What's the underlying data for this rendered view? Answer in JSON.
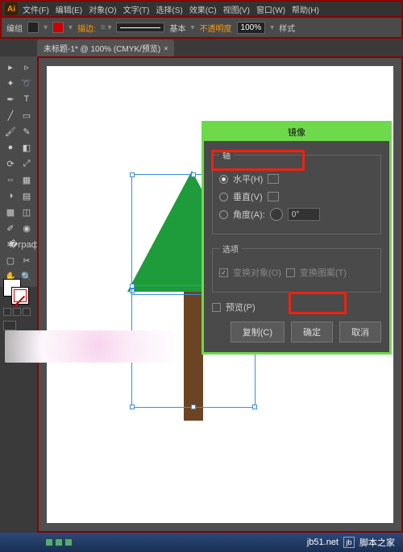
{
  "app": {
    "logo": "Ai"
  },
  "menu": {
    "file": "文件(F)",
    "edit": "编辑(E)",
    "object": "对象(O)",
    "type": "文字(T)",
    "select": "选择(S)",
    "effect": "效果(C)",
    "view": "视图(V)",
    "window": "窗口(W)",
    "help": "帮助(H)"
  },
  "control": {
    "mode": "编组",
    "stroke_label": "描边:",
    "basic_label": "基本",
    "opacity_label": "不透明度",
    "opacity_value": "100%",
    "style_label": "样式"
  },
  "tab": {
    "title": "未标题-1* @ 100% (CMYK/预览)"
  },
  "dialog": {
    "title": "镜像",
    "axis_legend": "轴",
    "horizontal": "水平(H)",
    "vertical": "垂直(V)",
    "angle_label": "角度(A):",
    "angle_value": "0°",
    "options_legend": "选项",
    "transform_objects": "变换对象(O)",
    "transform_patterns": "变换图案(T)",
    "preview": "预览(P)",
    "copy_btn": "复制(C)",
    "ok_btn": "确定",
    "cancel_btn": "取消"
  },
  "status": {
    "url": "jb51.net",
    "site": "脚本之家"
  },
  "chart_data": {
    "type": "vector-artwork",
    "description": "Simple tree: green triangle foliage on brown rectangular trunk, selection bounding box active",
    "colors": {
      "foliage": "#1e9b3a",
      "trunk": "#6b4423"
    }
  }
}
